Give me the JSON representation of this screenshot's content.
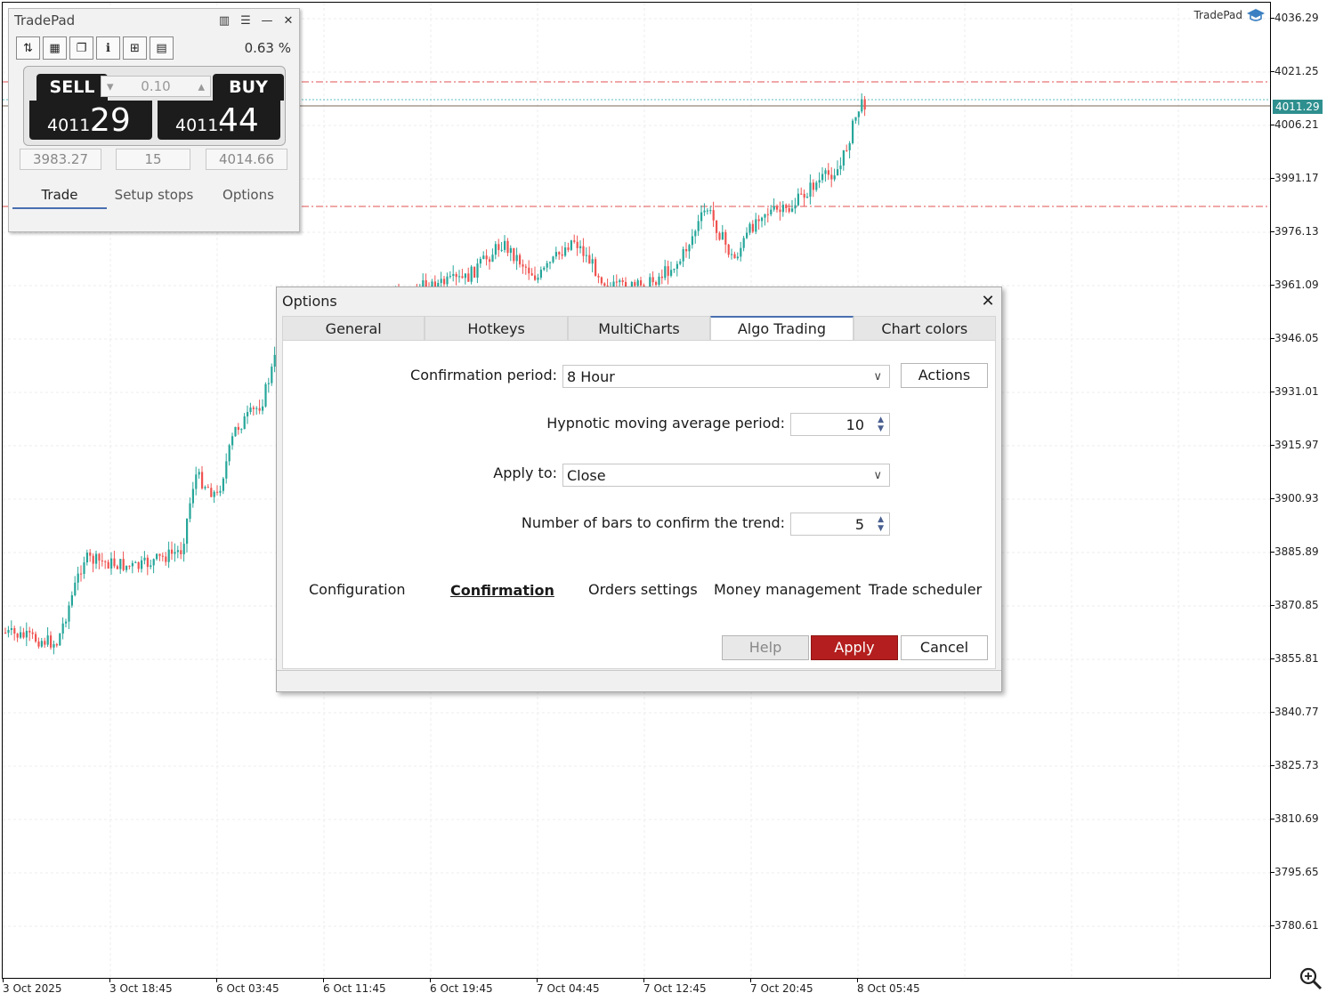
{
  "chart": {
    "price_labels": [
      "4036.29",
      "4021.25",
      "4006.21",
      "3991.17",
      "3976.13",
      "3961.09",
      "3946.05",
      "3931.01",
      "3915.97",
      "3900.93",
      "3885.89",
      "3870.85",
      "3855.81",
      "3840.77",
      "3825.73",
      "3810.69",
      "3795.65",
      "3780.61"
    ],
    "current_price": "4011.29",
    "time_labels": [
      "3 Oct 2025",
      "3 Oct 18:45",
      "6 Oct 03:45",
      "6 Oct 11:45",
      "6 Oct 19:45",
      "7 Oct 04:45",
      "7 Oct 12:45",
      "7 Oct 20:45",
      "8 Oct 05:45"
    ],
    "watermark": "TradePad",
    "colors": {
      "bull": "#26a69a",
      "bear": "#ef5350",
      "level": "#e05050",
      "bid_line": "#5fbfc0"
    }
  },
  "tradepad": {
    "title": "TradePad",
    "controls": [
      "bar-chart-icon",
      "list-icon",
      "minimize-icon",
      "close-icon"
    ],
    "tools": [
      "sort-icon",
      "grid-icon",
      "windows-icon",
      "info-icon",
      "split-icon",
      "table-icon"
    ],
    "percent": "0.63 %",
    "sell_label": "SELL",
    "buy_label": "BUY",
    "lot": "0.10",
    "sell_price_small": "4011.",
    "sell_price_large": "29",
    "buy_price_small": "4011.",
    "buy_price_large": "44",
    "sl_value": "3983.27",
    "points_value": "15",
    "tp_value": "4014.66",
    "tabs": [
      "Trade",
      "Setup stops",
      "Options"
    ]
  },
  "options": {
    "title": "Options",
    "close": "✕",
    "tabs": [
      "General",
      "Hotkeys",
      "MultiCharts",
      "Algo Trading",
      "Chart colors"
    ],
    "confirmation_period_label": "Confirmation period:",
    "confirmation_period_value": "8 Hour",
    "actions_label": "Actions",
    "hma_period_label": "Hypnotic moving average period:",
    "hma_period_value": "10",
    "apply_to_label": "Apply to:",
    "apply_to_value": "Close",
    "bars_confirm_label": "Number of bars to confirm the trend:",
    "bars_confirm_value": "5",
    "subtabs": [
      "Configuration",
      "Confirmation",
      "Orders settings",
      "Money management",
      "Trade scheduler"
    ],
    "help_label": "Help",
    "apply_label": "Apply",
    "cancel_label": "Cancel",
    "colors": {
      "apply_bg": "#b41e1e",
      "accent": "#4a6fb0"
    }
  }
}
